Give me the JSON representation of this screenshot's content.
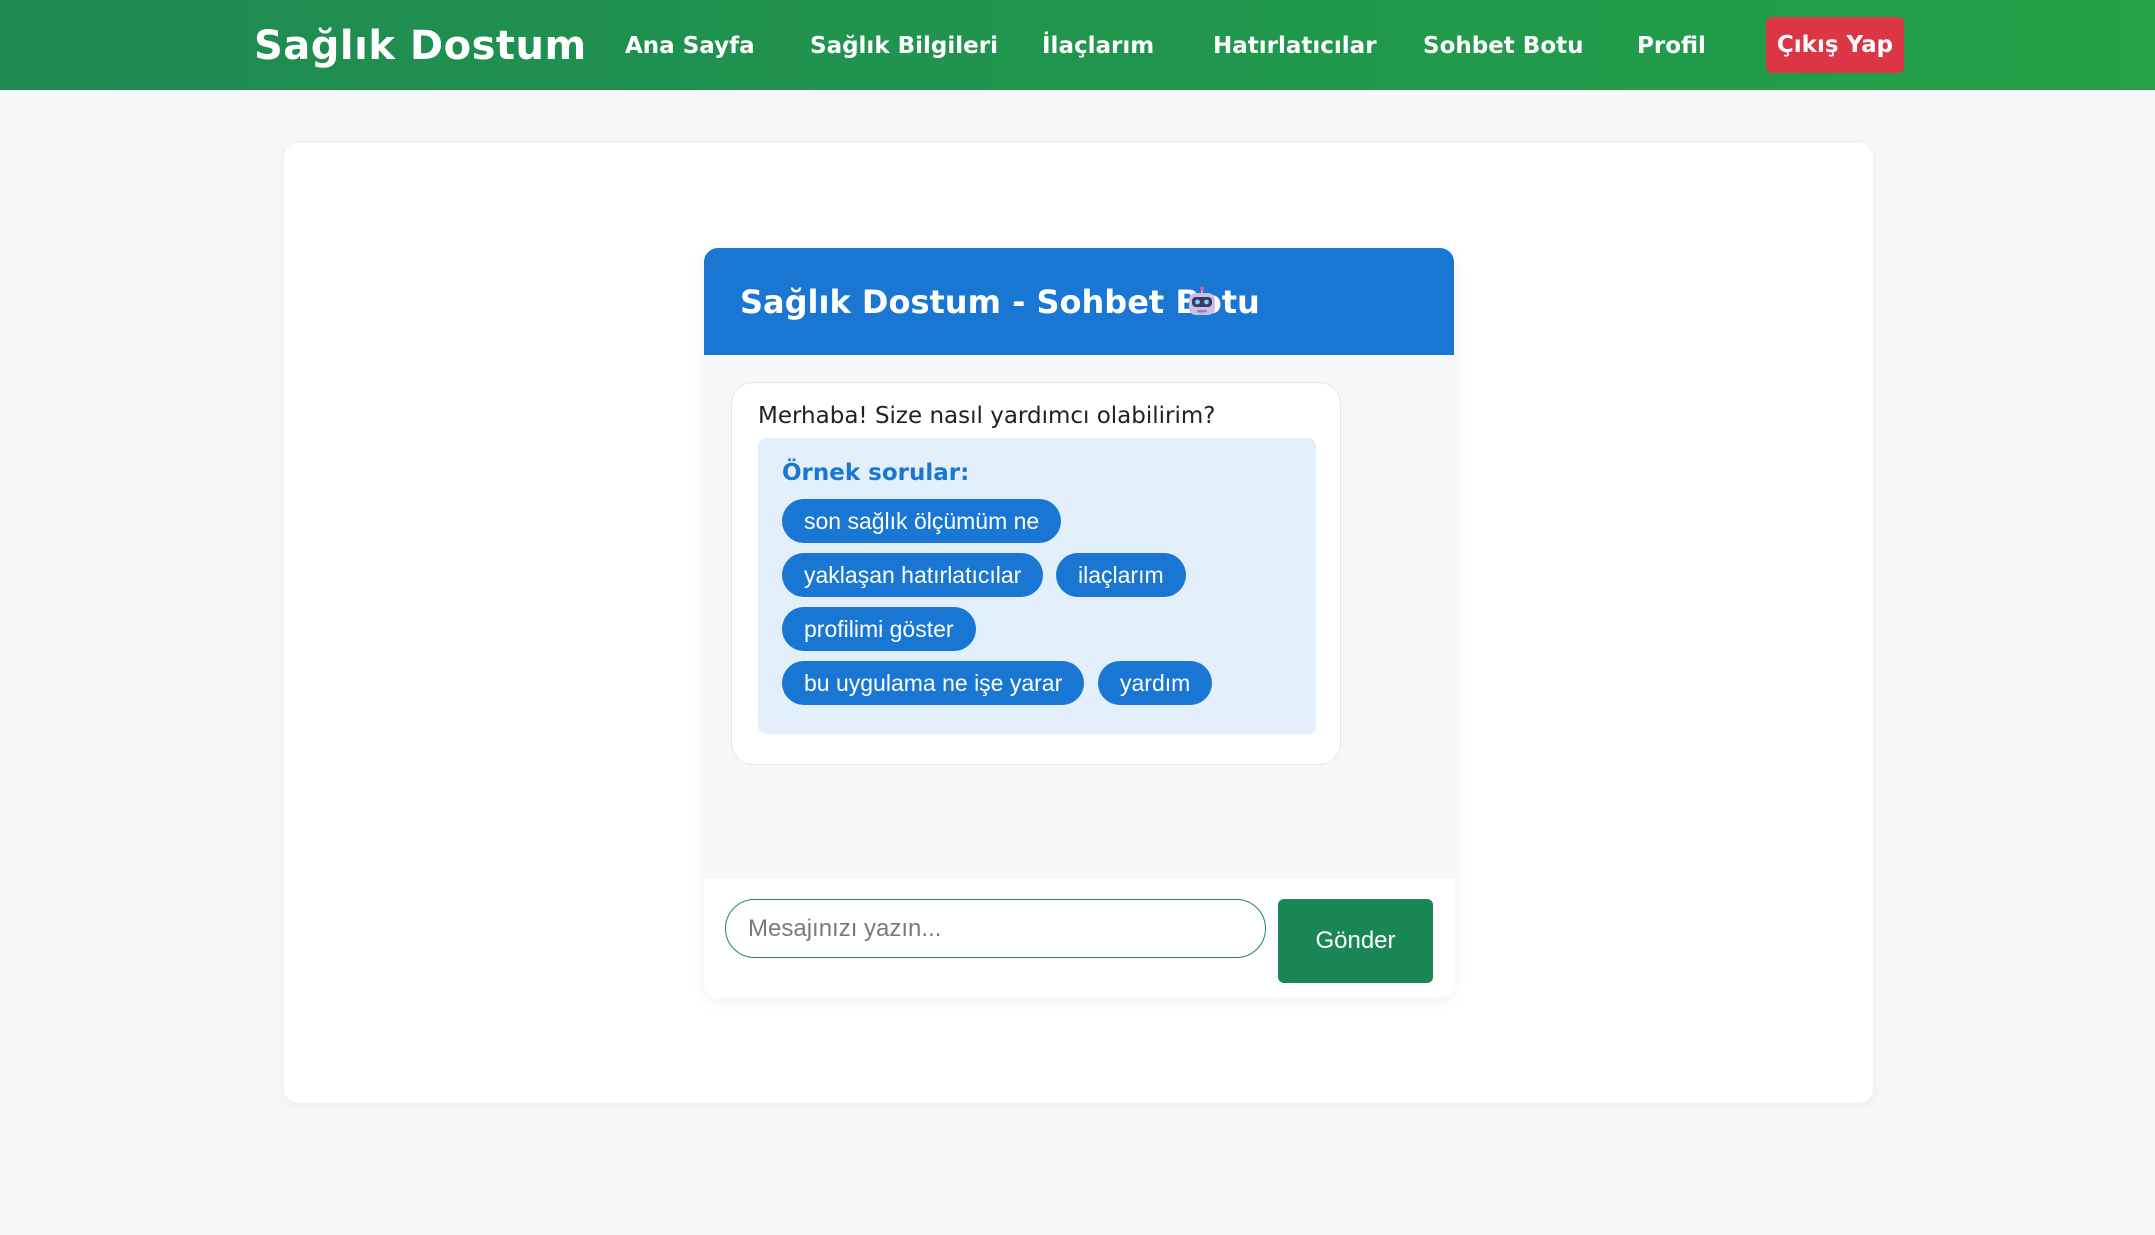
{
  "navbar": {
    "brand": "Sağlık Dostum",
    "items": [
      {
        "label": "Ana Sayfa"
      },
      {
        "label": "Sağlık Bilgileri"
      },
      {
        "label": "İlaçlarım"
      },
      {
        "label": "Hatırlatıcılar"
      },
      {
        "label": "Sohbet Botu"
      },
      {
        "label": "Profil"
      }
    ],
    "logout_label": "Çıkış Yap",
    "colors": {
      "bar_start": "#1e8a52",
      "bar_end": "#22a148",
      "logout": "#dc3545"
    }
  },
  "chat": {
    "title": "Sağlık Dostum - Sohbet Botu",
    "header_icon": "robot-icon",
    "header_color": "#1976d2",
    "bot_message": {
      "greeting": "Merhaba! Size nasıl yardımcı olabilirim?",
      "examples_title": "Örnek sorular:",
      "examples": [
        "son sağlık ölçümüm ne",
        "yaklaşan hatırlatıcılar",
        "ilaçlarım",
        "profilimi göster",
        "bu uygulama ne işe yarar",
        "yardım"
      ]
    },
    "input": {
      "value": "",
      "placeholder": "Mesajınızı yazın..."
    },
    "send_label": "Gönder",
    "send_color": "#198754"
  }
}
